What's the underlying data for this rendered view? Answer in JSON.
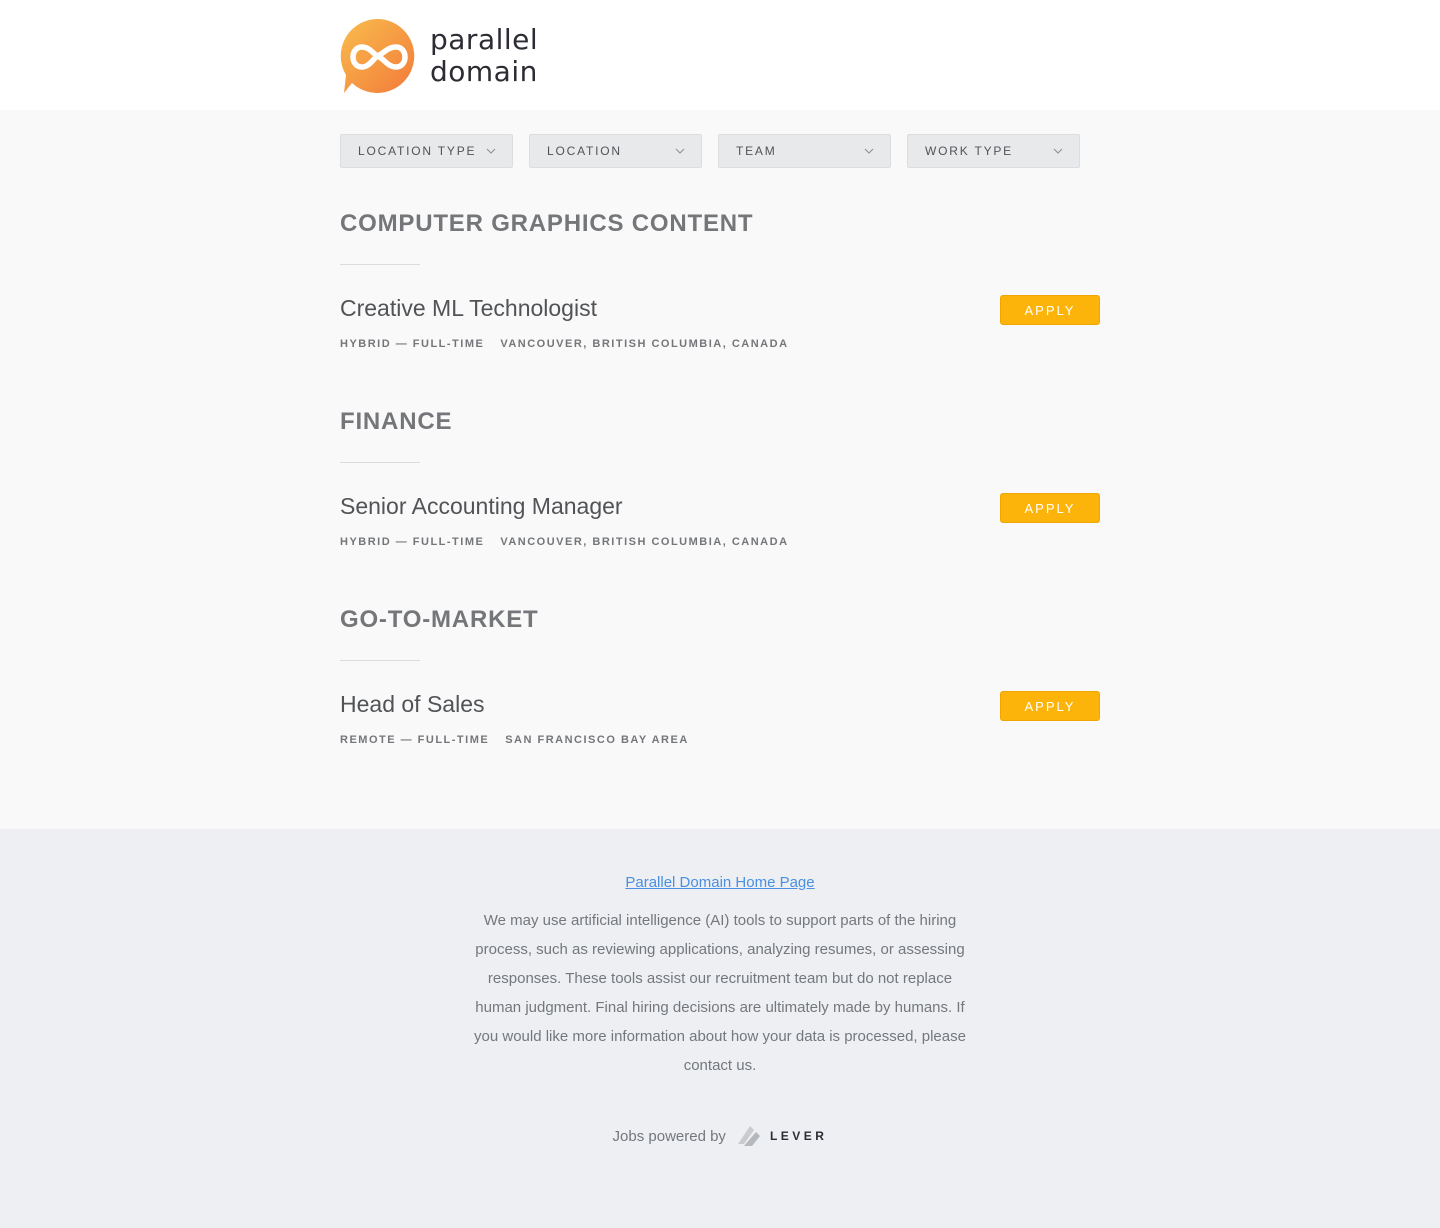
{
  "brand": {
    "name_line1": "parallel",
    "name_line2": "domain",
    "colors": {
      "gradient_start": "#f8b84a",
      "gradient_end": "#f3813c"
    }
  },
  "filters": [
    {
      "label": "LOCATION TYPE"
    },
    {
      "label": "LOCATION"
    },
    {
      "label": "TEAM"
    },
    {
      "label": "WORK TYPE"
    }
  ],
  "groups": [
    {
      "title": "COMPUTER GRAPHICS CONTENT",
      "postings": [
        {
          "title": "Creative ML Technologist",
          "worktype": "HYBRID — FULL-TIME",
          "location": "VANCOUVER, BRITISH COLUMBIA, CANADA",
          "apply_label": "APPLY"
        }
      ]
    },
    {
      "title": "FINANCE",
      "postings": [
        {
          "title": "Senior Accounting Manager",
          "worktype": "HYBRID — FULL-TIME",
          "location": "VANCOUVER, BRITISH COLUMBIA, CANADA",
          "apply_label": "APPLY"
        }
      ]
    },
    {
      "title": "GO-TO-MARKET",
      "postings": [
        {
          "title": "Head of Sales",
          "worktype": "REMOTE — FULL-TIME",
          "location": "SAN FRANCISCO BAY AREA",
          "apply_label": "APPLY"
        }
      ]
    }
  ],
  "footer": {
    "home_link": "Parallel Domain Home Page",
    "ai_notice": "We may use artificial intelligence (AI) tools to support parts of the hiring process, such as reviewing applications, analyzing resumes, or assessing responses. These tools assist our recruitment team but do not replace human judgment. Final hiring decisions are ultimately made by humans. If you would like more information about how your data is processed, please contact us.",
    "powered_by": "Jobs powered by",
    "lever": "LEVER"
  },
  "colors": {
    "apply_button": "#fcb40a",
    "link": "#4a90e2"
  }
}
